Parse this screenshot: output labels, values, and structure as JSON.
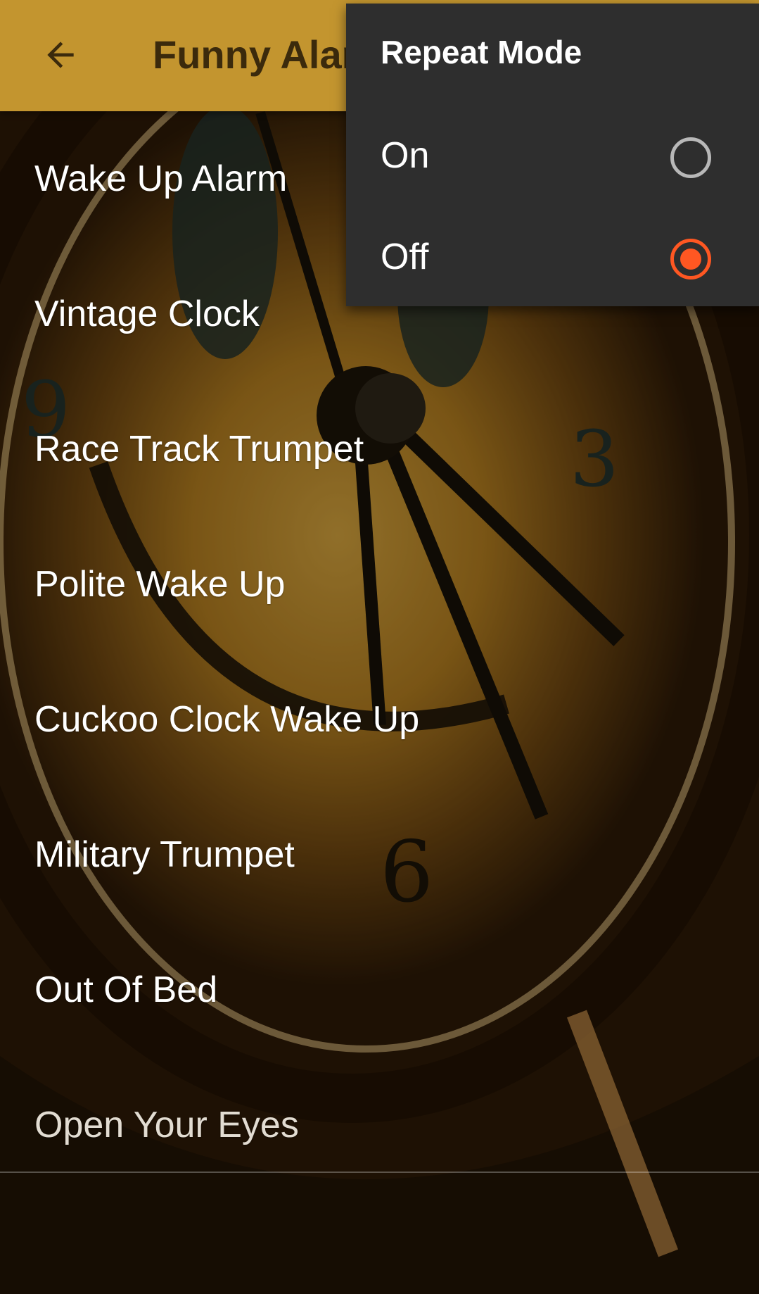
{
  "appbar": {
    "back_icon": "arrow-left-icon",
    "title": "Funny Alarm"
  },
  "alarms": [
    {
      "label": "Wake Up Alarm"
    },
    {
      "label": "Vintage Clock"
    },
    {
      "label": "Race Track Trumpet"
    },
    {
      "label": "Polite Wake Up"
    },
    {
      "label": "Cuckoo Clock Wake Up"
    },
    {
      "label": "Military Trumpet"
    },
    {
      "label": "Out Of Bed"
    },
    {
      "label": "Open Your Eyes"
    }
  ],
  "repeat_menu": {
    "title": "Repeat Mode",
    "options": [
      {
        "label": "On",
        "selected": false
      },
      {
        "label": "Off",
        "selected": true
      }
    ]
  },
  "colors": {
    "appbar": "#c3952f",
    "accent": "#ff5722",
    "popup": "#2e2e2e"
  }
}
